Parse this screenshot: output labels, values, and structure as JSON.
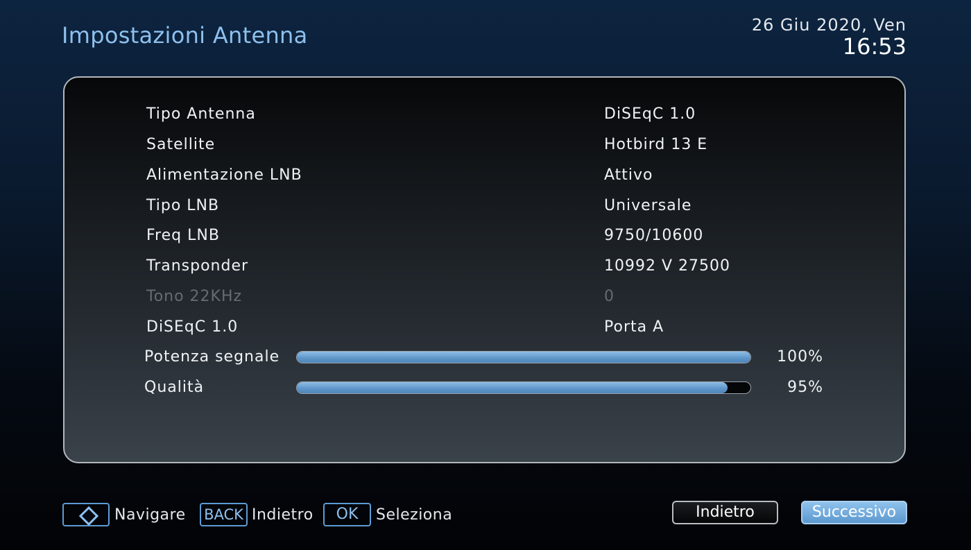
{
  "header": {
    "title": "Impostazioni Antenna",
    "date": "26 Giu 2020, Ven",
    "time": "16:53"
  },
  "settings": [
    {
      "label": "Tipo Antenna",
      "value": "DiSEqC 1.0",
      "enabled": true
    },
    {
      "label": "Satellite",
      "value": "Hotbird 13 E",
      "enabled": true
    },
    {
      "label": "Alimentazione LNB",
      "value": "Attivo",
      "enabled": true
    },
    {
      "label": "Tipo LNB",
      "value": "Universale",
      "enabled": true
    },
    {
      "label": "Freq LNB",
      "value": "9750/10600",
      "enabled": true
    },
    {
      "label": "Transponder",
      "value": "10992 V 27500",
      "enabled": true
    },
    {
      "label": "Tono 22KHz",
      "value": "0",
      "enabled": false
    },
    {
      "label": "DiSEqC 1.0",
      "value": "Porta A",
      "enabled": true
    }
  ],
  "meters": [
    {
      "label": "Potenza segnale",
      "value": "100%",
      "level": 100
    },
    {
      "label": "Qualità",
      "value": "95%",
      "level": 95
    }
  ],
  "footer": {
    "navigate_label": "Navigare",
    "back_key": "BACK",
    "back_label": "Indietro",
    "ok_key": "OK",
    "ok_label": "Seleziona"
  },
  "buttons": {
    "back": "Indietro",
    "next": "Successivo"
  },
  "colors": {
    "accent": "#8ec0ee",
    "bar_fill": "#5d95c8",
    "disabled_text": "#666b71"
  }
}
